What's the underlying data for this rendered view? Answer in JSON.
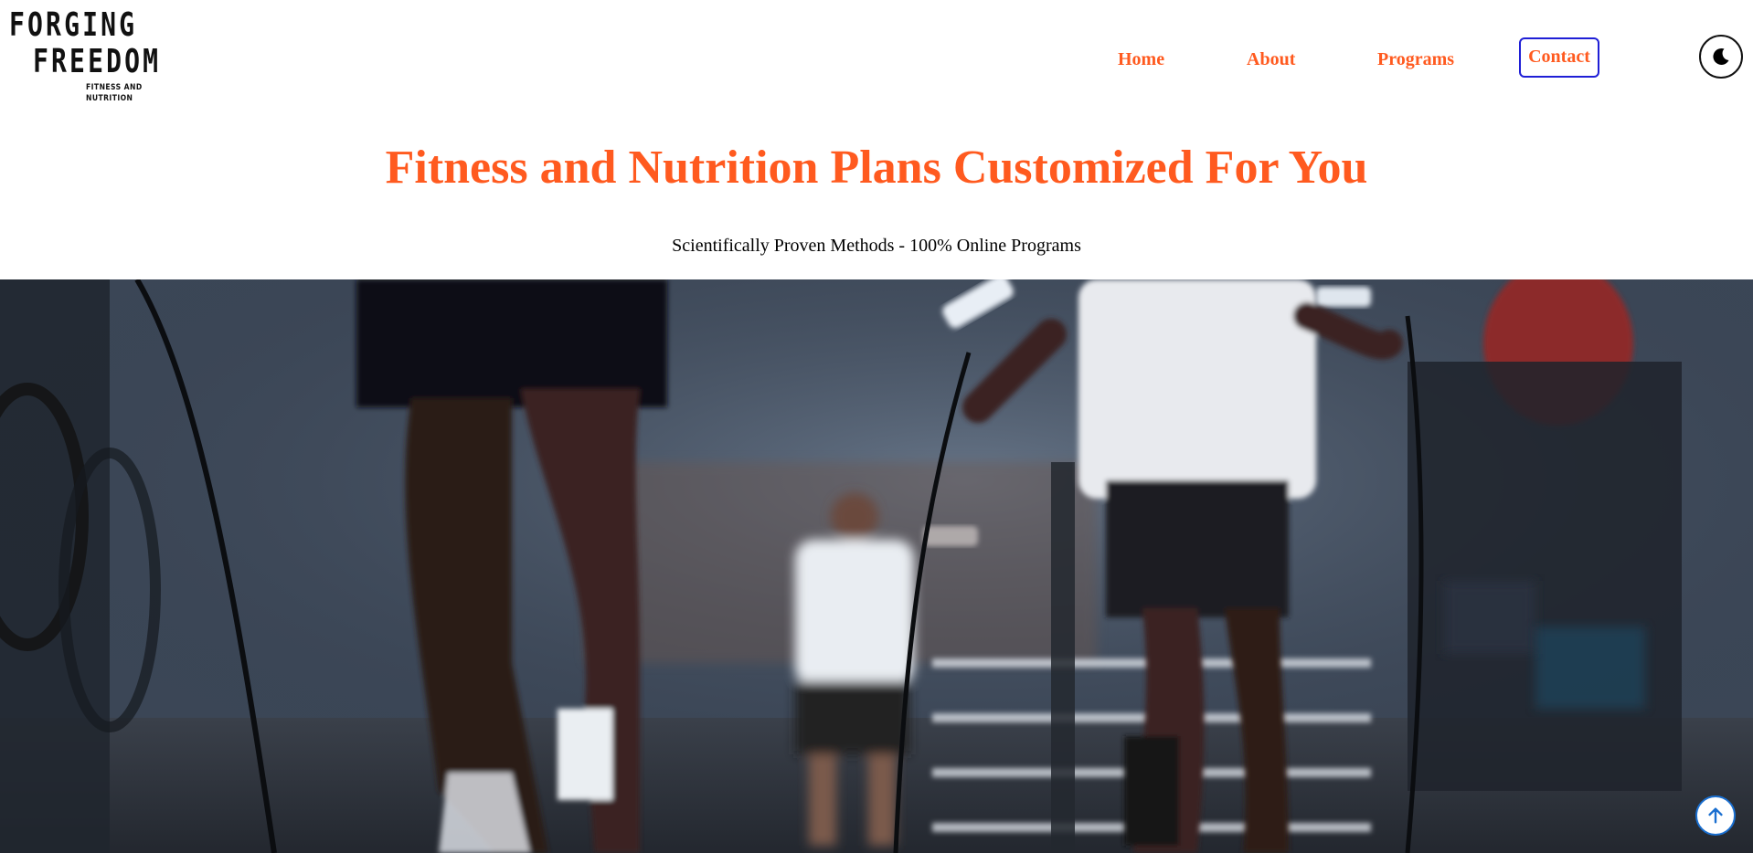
{
  "logo": {
    "line1": "FORGING",
    "line2": "FREEDOM",
    "line3": "FITNESS AND NUTRITION"
  },
  "nav": {
    "items": [
      {
        "label": "Home"
      },
      {
        "label": "About"
      },
      {
        "label": "Programs"
      },
      {
        "label": "Contact"
      }
    ]
  },
  "theme_toggle": {
    "icon": "moon-icon"
  },
  "hero": {
    "title": "Fitness and Nutrition Plans Customized For You",
    "subtitle": "Scientifically Proven Methods - 100% Online Programs"
  },
  "scroll_top": {
    "icon": "arrow-up-icon"
  },
  "colors": {
    "accent": "#ff5a1f",
    "contact_border": "#1f1fd6",
    "scroll_button_border": "#1a6fd0"
  }
}
